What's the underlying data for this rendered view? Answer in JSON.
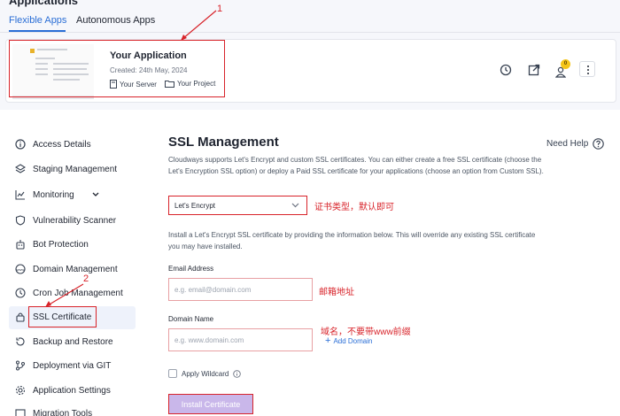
{
  "header": {
    "app_heading": "Applications",
    "tabs": [
      {
        "label": "Flexible Apps",
        "active": true
      },
      {
        "label": "Autonomous Apps",
        "active": false
      }
    ]
  },
  "app_card": {
    "title": "Your Application",
    "created": "Created: 24th May, 2024",
    "server": "Your Server",
    "project": "Your Project",
    "notification_count": "0",
    "icons": [
      "history-icon",
      "open-external-icon",
      "user-icon",
      "more-vertical-icon"
    ]
  },
  "annotations": {
    "one": "1",
    "two": "2",
    "ssl_type_note": "证书类型，默认即可",
    "email_note": "邮箱地址",
    "domain_note": "域名，不要带www前缀"
  },
  "sidebar": {
    "items": [
      {
        "label": "Access Details",
        "icon": "info-icon"
      },
      {
        "label": "Staging Management",
        "icon": "layers-icon"
      },
      {
        "label": "Monitoring",
        "icon": "chart-icon"
      },
      {
        "label": "Vulnerability Scanner",
        "icon": "shield-icon"
      },
      {
        "label": "Bot Protection",
        "icon": "bot-icon"
      },
      {
        "label": "Domain Management",
        "icon": "www-icon"
      },
      {
        "label": "Cron Job Management",
        "icon": "clock-icon"
      },
      {
        "label": "SSL Certificate",
        "icon": "lock-icon",
        "active": true
      },
      {
        "label": "Backup and Restore",
        "icon": "restore-icon"
      },
      {
        "label": "Deployment via GIT",
        "icon": "git-icon"
      },
      {
        "label": "Application Settings",
        "icon": "gear-icon"
      },
      {
        "label": "Migration Tools",
        "icon": "migrate-icon"
      }
    ]
  },
  "main": {
    "title": "SSL Management",
    "need_help": "Need Help",
    "intro": "Cloudways supports Let's Encrypt and custom SSL certificates. You can either create a free SSL certificate (choose the Let's Encryption SSL option) or deploy a Paid SSL certificate for your applications (choose an option from Custom SSL).",
    "ssl_type_selected": "Let's Encrypt",
    "instructions": "Install a Let's Encrypt SSL certificate by providing the information below. This will override any existing SSL certificate you may have installed.",
    "email_label": "Email Address",
    "email_placeholder": "e.g. email@domain.com",
    "domain_label": "Domain Name",
    "domain_placeholder": "e.g. www.domain.com",
    "add_domain": "Add Domain",
    "apply_wildcard": "Apply Wildcard",
    "install_button": "Install Certificate"
  },
  "colors": {
    "accent": "#2a6ed6",
    "annotation_red": "#d8232a",
    "button_disabled": "#c9b7ea",
    "badge": "#f5c518"
  }
}
